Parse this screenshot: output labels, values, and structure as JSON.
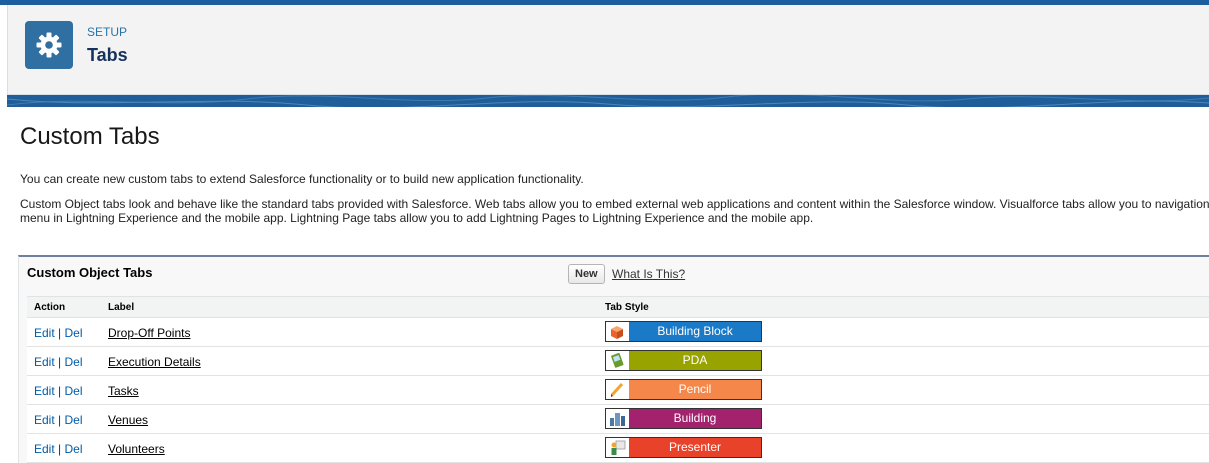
{
  "header": {
    "setup_label": "SETUP",
    "title": "Tabs",
    "icon": "gear-icon"
  },
  "main": {
    "heading": "Custom Tabs",
    "intro": "You can create new custom tabs to extend Salesforce functionality or to build new application functionality.",
    "description": "Custom Object tabs look and behave like the standard tabs provided with Salesforce. Web tabs allow you to embed external web applications and content within the Salesforce window. Visualforce tabs allow you to navigation menu in Lightning Experience and the mobile app. Lightning Page tabs allow you to add Lightning Pages to Lightning Experience and the mobile app."
  },
  "panel": {
    "title": "Custom Object Tabs",
    "new_label": "New",
    "what_label": "What Is This?",
    "columns": [
      "Action",
      "Label",
      "Tab Style"
    ],
    "rows": [
      {
        "edit": "Edit",
        "sep": "|",
        "del": "Del",
        "label": "Drop-Off Points",
        "style": "Building Block",
        "color": "#1a7ac8",
        "icon": "building-block-icon"
      },
      {
        "edit": "Edit",
        "sep": "|",
        "del": "Del",
        "label": "Execution Details",
        "style": "PDA",
        "color": "#99a300",
        "icon": "pda-icon"
      },
      {
        "edit": "Edit",
        "sep": "|",
        "del": "Del",
        "label": "Tasks",
        "style": "Pencil",
        "color": "#f5874a",
        "icon": "pencil-icon"
      },
      {
        "edit": "Edit",
        "sep": "|",
        "del": "Del",
        "label": "Venues",
        "style": "Building",
        "color": "#a3226e",
        "icon": "building-icon"
      },
      {
        "edit": "Edit",
        "sep": "|",
        "del": "Del",
        "label": "Volunteers",
        "style": "Presenter",
        "color": "#e8432a",
        "icon": "presenter-icon"
      }
    ]
  }
}
